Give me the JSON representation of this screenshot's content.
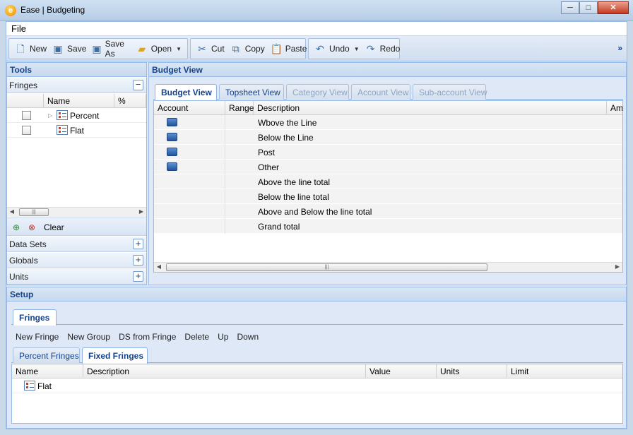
{
  "window": {
    "title": "Ease | Budgeting",
    "app_icon": "ease-logo-icon"
  },
  "menu": {
    "file": "File"
  },
  "toolbar": {
    "new": "New",
    "save": "Save",
    "save_as": "Save As",
    "open": "Open",
    "cut": "Cut",
    "copy": "Copy",
    "paste": "Paste",
    "undo": "Undo",
    "redo": "Redo",
    "more": "»"
  },
  "tools": {
    "title": "Tools",
    "fringes": {
      "label": "Fringes",
      "columns": [
        "Name",
        "%"
      ],
      "rows": [
        {
          "name": "Percent"
        },
        {
          "name": "Flat"
        }
      ],
      "clear": "Clear"
    },
    "sections": [
      "Data Sets",
      "Globals",
      "Units"
    ]
  },
  "budget_view": {
    "title": "Budget View",
    "tabs": [
      "Budget View",
      "Topsheet View",
      "Category View",
      "Account View",
      "Sub-account View"
    ],
    "columns": [
      "Account",
      "Range",
      "Description",
      "Amo"
    ],
    "rows": [
      "Wbove the Line",
      "Below the Line",
      "Post",
      "Other",
      "Above the line total",
      "Below the line total",
      "Above and Below the line total",
      "Grand total"
    ]
  },
  "setup": {
    "title": "Setup",
    "tab": "Fringes",
    "actions": [
      "New Fringe",
      "New Group",
      "DS from Fringe",
      "Delete",
      "Up",
      "Down"
    ],
    "subtabs": [
      "Percent Fringes",
      "Fixed Fringes"
    ],
    "columns": [
      "Name",
      "Description",
      "Value",
      "Units",
      "Limit"
    ],
    "rows": [
      {
        "name": "Flat"
      }
    ]
  }
}
